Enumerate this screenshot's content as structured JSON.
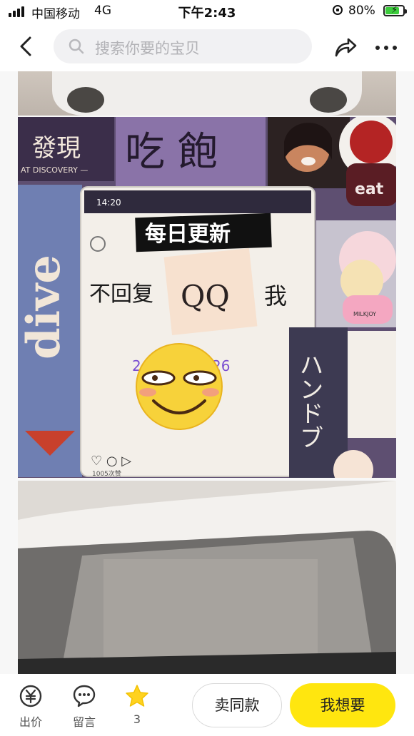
{
  "status_bar": {
    "carrier": "中国移动",
    "network": "4G",
    "time": "下午2:43",
    "battery_percent": "80%",
    "battery_level": 0.8
  },
  "topbar": {
    "search_placeholder": "搜索你要的宝贝"
  },
  "photo": {
    "top_label": "每日更新",
    "sign_discovery": "發現",
    "sign_discovery_sub": "AT DISCOVERY —",
    "sign_eat": "吃 飽",
    "phone_time": "14:20",
    "reply_text_left": "不回复",
    "reply_qq": "QQ",
    "reply_text_right": "我",
    "dive_text": "dive",
    "hand_text": "ハンドブ",
    "eat_badge": "eat",
    "milky": "MILKJOY",
    "likes_text": "1005次赞",
    "number_left": "24",
    "number_right": "26"
  },
  "bottom": {
    "offer_label": "出价",
    "message_label": "留言",
    "fav_count": "3",
    "same_button": "卖同款",
    "want_button": "我想要"
  },
  "colors": {
    "accent": "#ffe60f"
  }
}
